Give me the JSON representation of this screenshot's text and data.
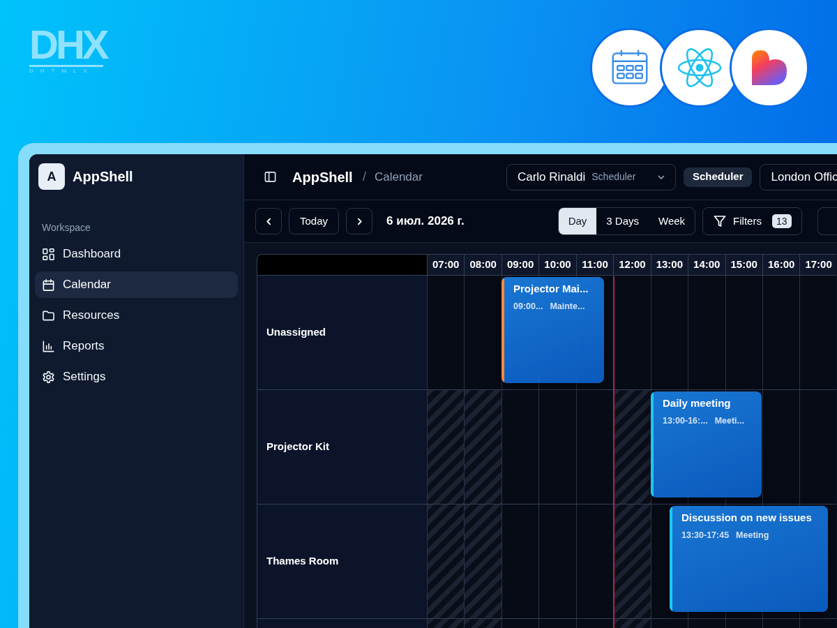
{
  "logo": {
    "mark": "DHX",
    "wordmark": "DHTMLX"
  },
  "badges": [
    {
      "kind": "calendar"
    },
    {
      "kind": "atom"
    },
    {
      "kind": "heart"
    }
  ],
  "sidebar": {
    "app_initial": "A",
    "app_name": "AppShell",
    "section": "Workspace",
    "items": [
      {
        "label": "Dashboard",
        "kind": "dashboard",
        "selected": false
      },
      {
        "label": "Calendar",
        "kind": "calendar",
        "selected": true
      },
      {
        "label": "Resources",
        "kind": "folder",
        "selected": false
      },
      {
        "label": "Reports",
        "kind": "chart",
        "selected": false
      },
      {
        "label": "Settings",
        "kind": "gear",
        "selected": false
      }
    ]
  },
  "header": {
    "title": "AppShell",
    "separator": "/",
    "page": "Calendar",
    "user": {
      "name": "Carlo Rinaldi",
      "role": "Scheduler"
    },
    "role_badge": "Scheduler",
    "location": "London Offic"
  },
  "toolbar": {
    "today": "Today",
    "date": "6 июл. 2026 г.",
    "views": [
      {
        "label": "Day",
        "selected": true
      },
      {
        "label": "3 Days",
        "selected": false
      },
      {
        "label": "Week",
        "selected": false
      }
    ],
    "filters": {
      "label": "Filters",
      "count": "13"
    }
  },
  "timeline": {
    "hours": [
      "07:00",
      "08:00",
      "09:00",
      "10:00",
      "11:00",
      "12:00",
      "13:00",
      "14:00",
      "15:00",
      "16:00",
      "17:00"
    ],
    "rows": [
      {
        "name": "Unassigned",
        "blocked": [
          false,
          false,
          false,
          false,
          false,
          false,
          false,
          false,
          false,
          false,
          false
        ],
        "events": [
          {
            "title": "Projector Mai...",
            "time": "09:00...",
            "type": "Mainte...",
            "color": "#ff8a3d"
          }
        ]
      },
      {
        "name": "Projector Kit",
        "blocked": [
          true,
          true,
          false,
          false,
          false,
          true,
          false,
          false,
          false,
          false,
          false
        ],
        "events": [
          {
            "title": "Daily meeting",
            "time": "13:00-16:...",
            "type": "Meeti...",
            "color": "#1ec8f0"
          }
        ]
      },
      {
        "name": "Thames Room",
        "blocked": [
          true,
          true,
          false,
          false,
          false,
          true,
          false,
          false,
          false,
          false,
          false
        ],
        "events": [
          {
            "title": "Discussion on new issues",
            "time": "13:30-17:45",
            "type": "Meeting",
            "color": "#1ec8f0"
          }
        ]
      },
      {
        "blocked": [
          true,
          true,
          false,
          false,
          false,
          true,
          false,
          false,
          false,
          false,
          false
        ]
      }
    ]
  }
}
